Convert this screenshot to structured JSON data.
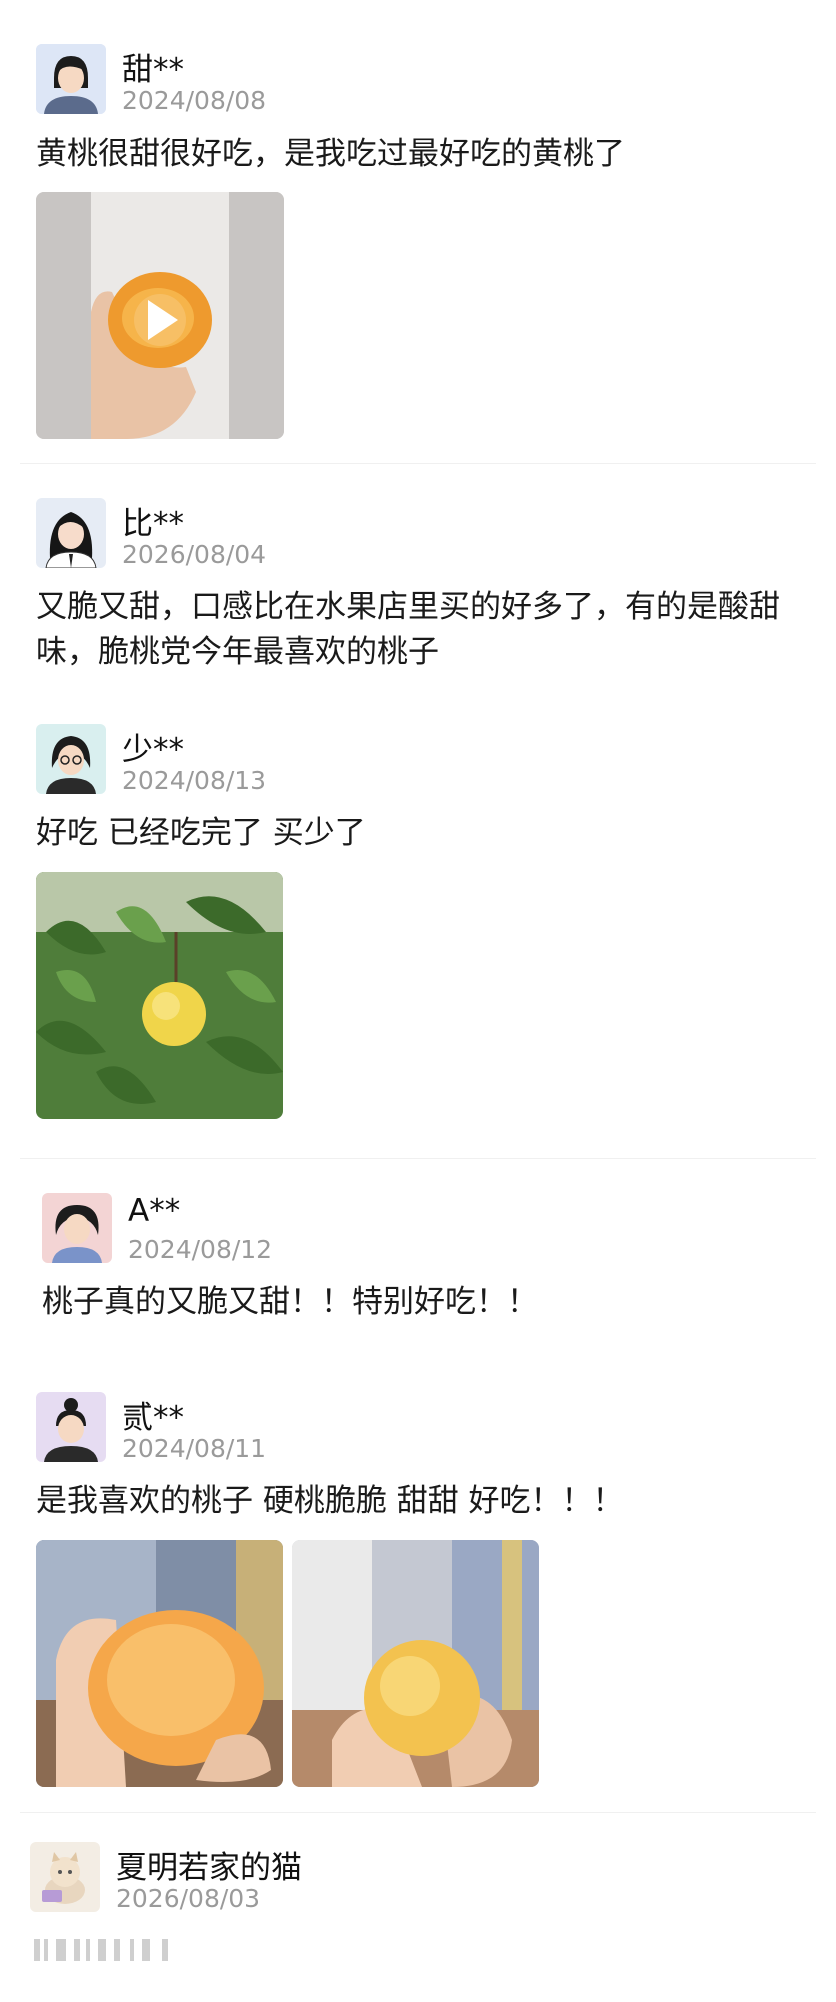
{
  "reviews": [
    {
      "user": "甜**",
      "date": "2024/08/08",
      "text": "黄桃很甜很好吃，是我吃过最好吃的黄桃了",
      "media": [
        "video-peach-in-hand"
      ]
    },
    {
      "user": "比**",
      "date": "2026/08/04",
      "text": "又脆又甜，口感比在水果店里买的好多了，有的是酸甜味，脆桃党今年最喜欢的桃子",
      "media": []
    },
    {
      "user": "少**",
      "date": "2024/08/13",
      "text": "好吃 已经吃完了 买少了",
      "media": [
        "photo-peach-on-tree"
      ]
    },
    {
      "user": "A**",
      "date": "2024/08/12",
      "text": "桃子真的又脆又甜！！特别好吃！！",
      "media": []
    },
    {
      "user": "贰**",
      "date": "2024/08/11",
      "text": "是我喜欢的桃子 硬桃脆脆 甜甜 好吃！！！",
      "media": [
        "photo-bitten-peach",
        "photo-whole-peach"
      ]
    },
    {
      "user": "夏明若家的猫",
      "date": "2026/08/03",
      "text": "",
      "media": []
    }
  ],
  "colors": {
    "date": "#9a9a9a",
    "divider": "#f0f0f0",
    "peach": "#f2b23d"
  }
}
